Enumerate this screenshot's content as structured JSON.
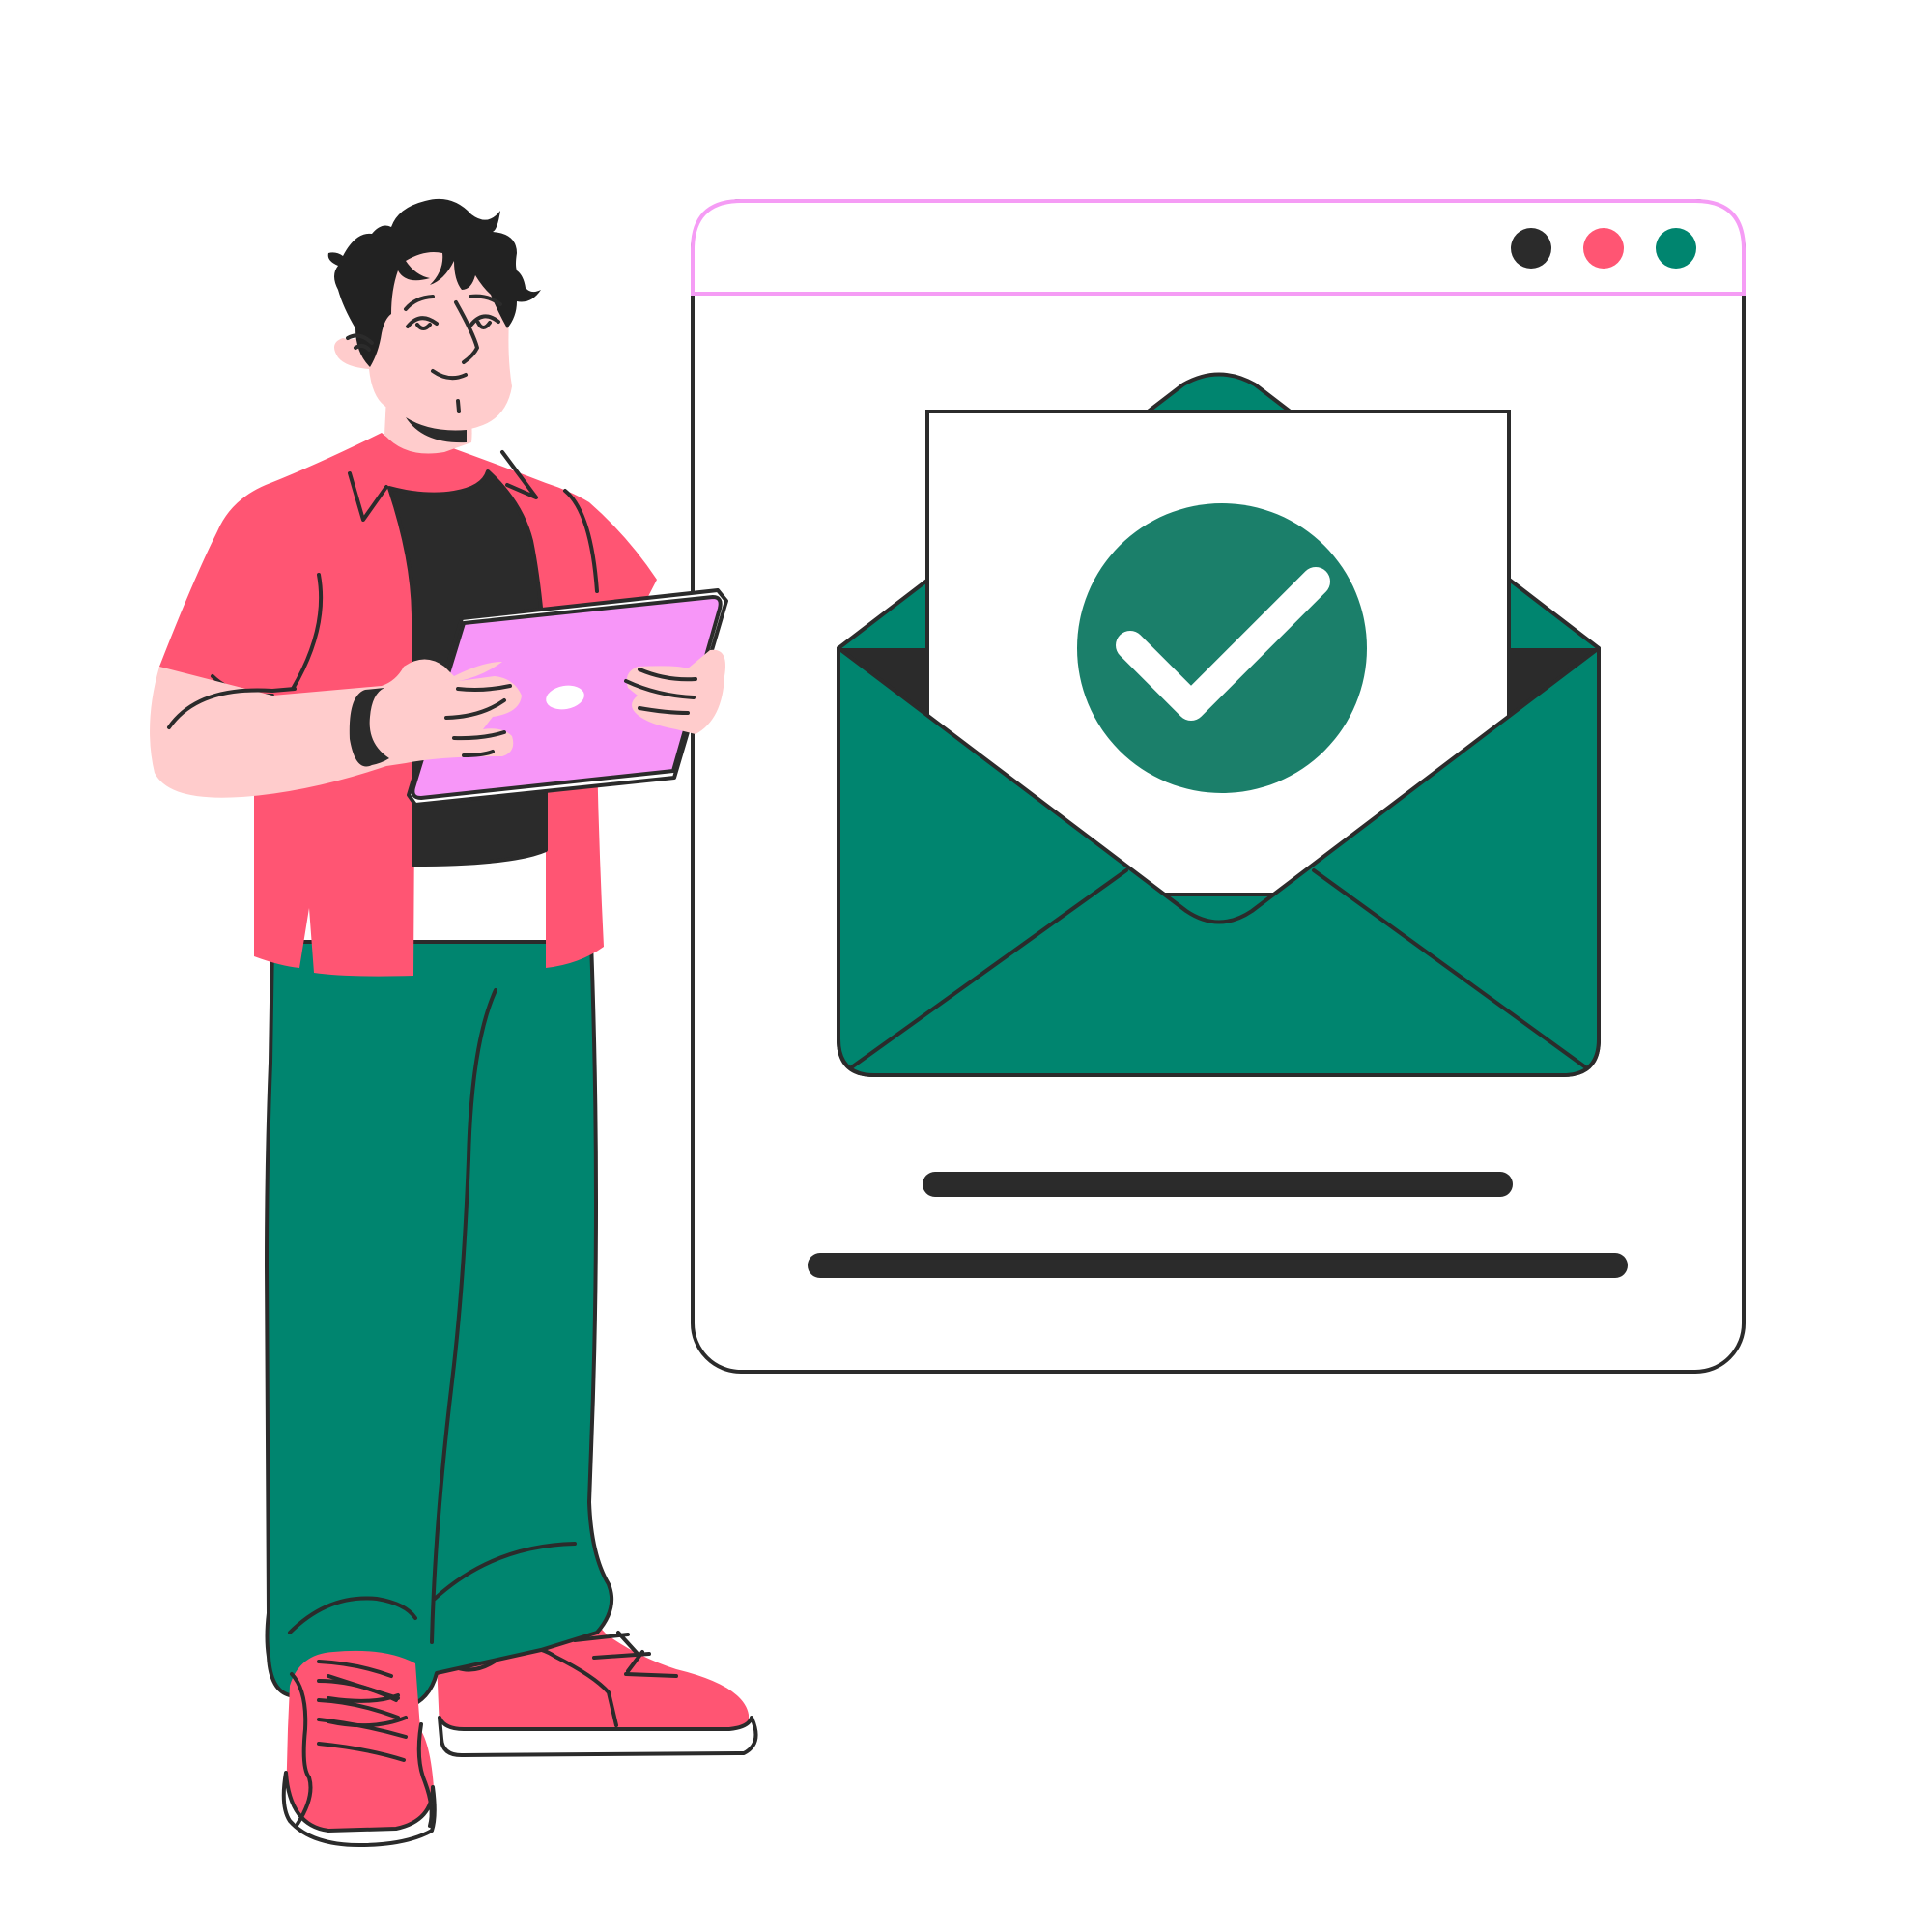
{
  "colors": {
    "background": "#ffffff",
    "outline": "#2b2b2b",
    "browser_frame_accent": "#f59cf5",
    "dot_dark": "#2b2b2b",
    "dot_red": "#ff5573",
    "dot_green": "#00856f",
    "envelope_green": "#00856f",
    "check_badge": "#1b7f6a",
    "skin": "#ffcccc",
    "shirt": "#ff5573",
    "tshirt": "#2b2b2b",
    "pants": "#00856f",
    "shoes": "#ff5573",
    "tablet": "#f796f8",
    "hair": "#222222"
  },
  "browser_window": {
    "window_controls": [
      "dot-dark",
      "dot-red",
      "dot-green"
    ]
  },
  "illustration": {
    "envelope_icon": "envelope-open-icon",
    "status_icon": "checkmark-circle-icon",
    "text_placeholder_lines": 2,
    "person": "man-holding-tablet"
  }
}
